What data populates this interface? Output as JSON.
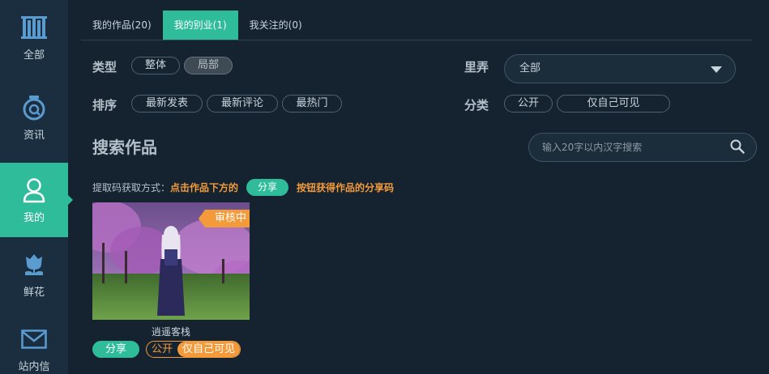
{
  "sidebar": {
    "items": [
      {
        "label": "全部",
        "icon": "bookshelf-icon"
      },
      {
        "label": "资讯",
        "icon": "news-icon"
      },
      {
        "label": "我的",
        "icon": "user-icon"
      },
      {
        "label": "鲜花",
        "icon": "flower-icon"
      },
      {
        "label": "站内信",
        "icon": "mail-icon"
      }
    ],
    "active_index": 2
  },
  "tabs": [
    {
      "label": "我的作品(20)"
    },
    {
      "label": "我的别业(1)"
    },
    {
      "label": "我关注的(0)"
    }
  ],
  "filters": {
    "type_label": "类型",
    "type_options": [
      "整体",
      "局部"
    ],
    "type_selected": "局部",
    "sort_label": "排序",
    "sort_options": [
      "最新发表",
      "最新评论",
      "最热门"
    ],
    "lane_label": "里弄",
    "lane_value": "全部",
    "category_label": "分类",
    "category_options": [
      "公开",
      "仅自己可见"
    ]
  },
  "search": {
    "title": "搜索作品",
    "placeholder": "输入20字以内汉字搜索"
  },
  "tip": {
    "prefix": "提取码获取方式：",
    "highlight1": "点击作品下方的",
    "button": "分享",
    "highlight2": "按钮获得作品的分享码"
  },
  "works": [
    {
      "title": "逍遥客栈",
      "status_badge": "审核中",
      "share_label": "分享",
      "visibility_public": "公开",
      "visibility_private": "仅自己可见",
      "visibility_selected": "仅自己可见"
    }
  ],
  "colors": {
    "accent": "#2fbc9b",
    "orange": "#f39a3a",
    "background": "#152331",
    "sidebar": "#1b2e3f"
  }
}
